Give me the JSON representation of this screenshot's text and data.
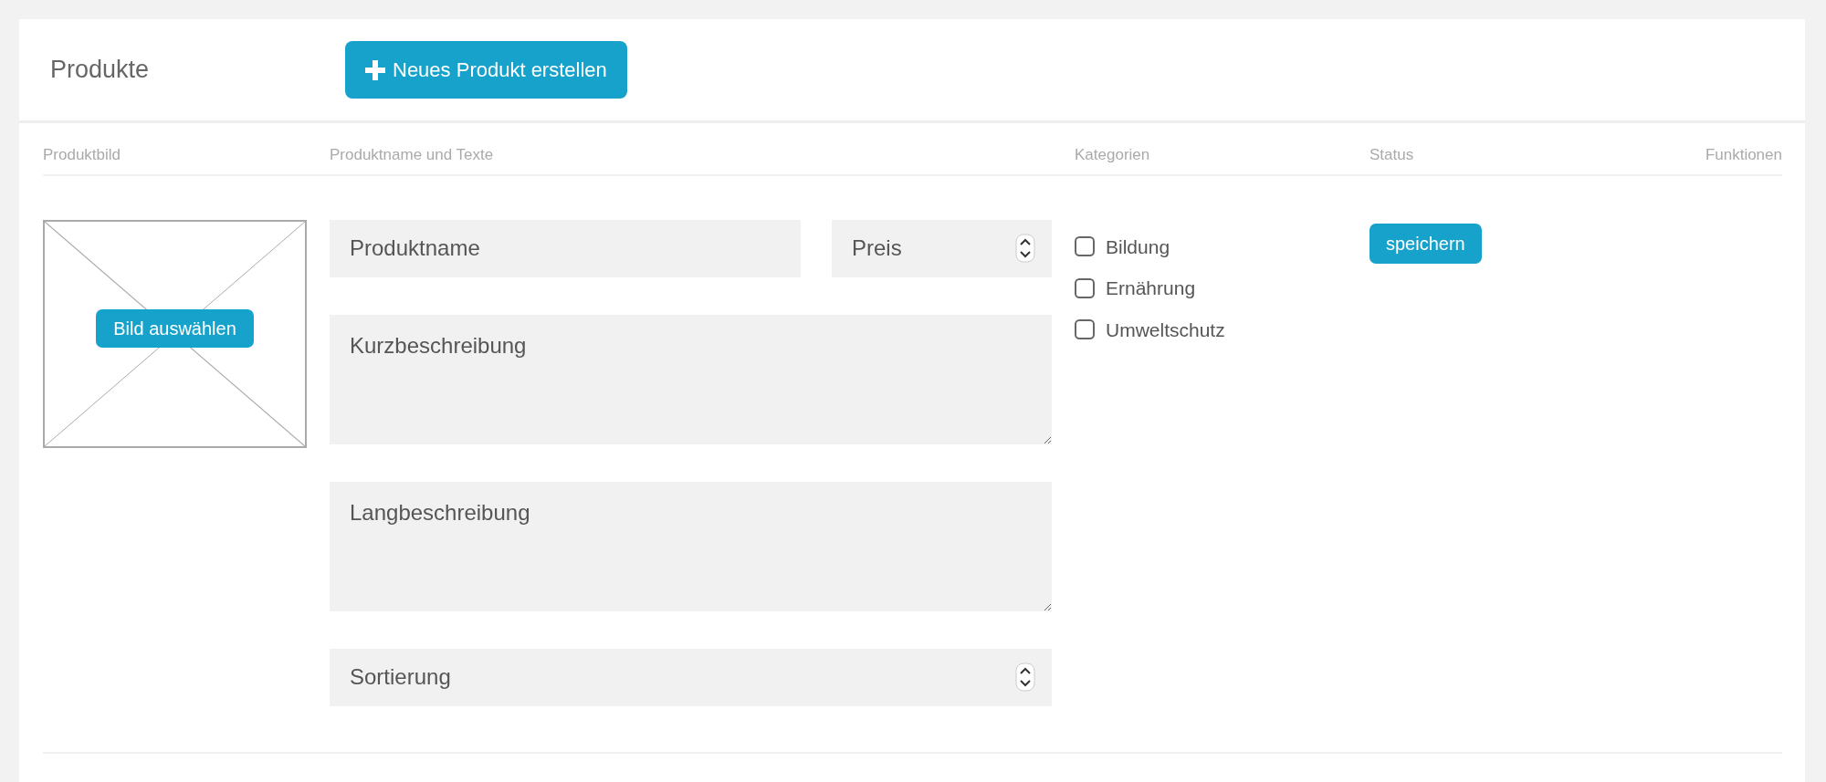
{
  "header": {
    "title": "Produkte",
    "create_button": "Neues Produkt erstellen"
  },
  "columns": [
    "Produktbild",
    "Produktname und Texte",
    "Kategorien",
    "Status",
    "Funktionen"
  ],
  "product": {
    "image_button": "Bild auswählen",
    "fields": [
      {
        "kind": "text",
        "placeholder": "Produktname"
      },
      {
        "kind": "number",
        "placeholder": "Preis"
      },
      {
        "kind": "textarea",
        "placeholder": "Kurzbeschreibung"
      },
      {
        "kind": "textarea",
        "placeholder": "Langbeschreibung"
      },
      {
        "kind": "number",
        "placeholder": "Sortierung"
      }
    ],
    "categories": [
      {
        "label": "Bildung",
        "checked": false
      },
      {
        "label": "Ernährung",
        "checked": false
      },
      {
        "label": "Umweltschutz",
        "checked": false
      }
    ],
    "save_button": "speichern"
  }
}
